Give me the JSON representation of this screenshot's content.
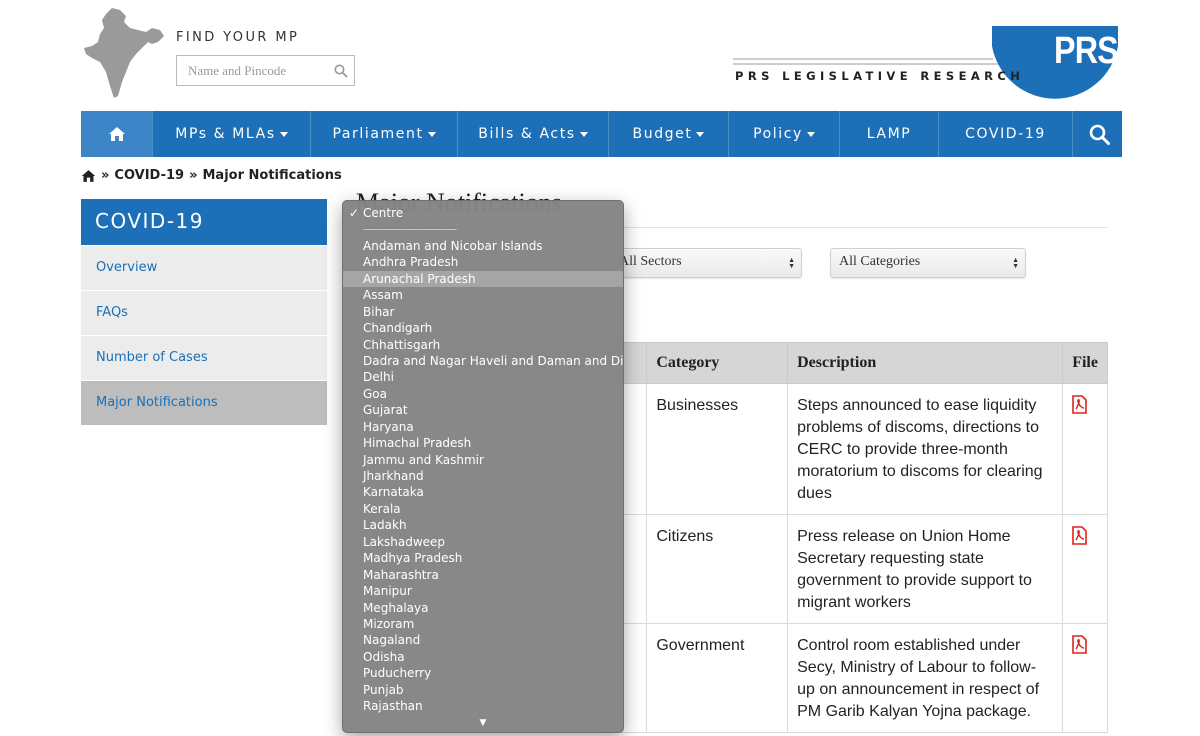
{
  "header": {
    "find_mp_label": "FIND YOUR MP",
    "search_placeholder": "Name and Pincode",
    "logo_text": "PRS LEGISLATIVE RESEARCH",
    "logo_word": "PRS"
  },
  "nav": {
    "items": [
      {
        "label": "MPs & MLAs",
        "dropdown": true
      },
      {
        "label": "Parliament",
        "dropdown": true
      },
      {
        "label": "Bills & Acts",
        "dropdown": true
      },
      {
        "label": "Budget",
        "dropdown": true
      },
      {
        "label": "Policy",
        "dropdown": true
      },
      {
        "label": "LAMP",
        "dropdown": false
      },
      {
        "label": "COVID-19",
        "dropdown": false
      }
    ]
  },
  "breadcrumb": {
    "sep": "»",
    "items": [
      "COVID-19",
      "Major Notifications"
    ]
  },
  "sidebar": {
    "title": "COVID-19",
    "items": [
      {
        "label": "Overview",
        "active": false
      },
      {
        "label": "FAQs",
        "active": false
      },
      {
        "label": "Number of Cases",
        "active": false
      },
      {
        "label": "Major Notifications",
        "active": true
      }
    ]
  },
  "main": {
    "title": "Major Notifications",
    "filters": {
      "sectors": "All Sectors",
      "categories": "All Categories"
    },
    "table": {
      "headers": [
        "Category",
        "Description",
        "File"
      ],
      "rows": [
        {
          "category": "Businesses",
          "description": "Steps announced to ease liquidity problems of discoms, directions to CERC to provide three-month moratorium to discoms for clearing dues"
        },
        {
          "category": "Citizens",
          "description": "Press release on Union Home Secretary requesting state government to provide support to migrant workers"
        },
        {
          "category": "Government",
          "description": "Control room established under Secy, Ministry of Labour to follow-up on announcement in respect of PM Garib Kalyan Yojna package."
        }
      ]
    }
  },
  "dropdown": {
    "selected": "Centre",
    "separator": "----------------------------",
    "highlighted": "Arunachal Pradesh",
    "options": [
      "Andaman and Nicobar Islands",
      "Andhra Pradesh",
      "Arunachal Pradesh",
      "Assam",
      "Bihar",
      "Chandigarh",
      "Chhattisgarh",
      "Dadra and Nagar Haveli and Daman and Diu",
      "Delhi",
      "Goa",
      "Gujarat",
      "Haryana",
      "Himachal Pradesh",
      "Jammu and Kashmir",
      "Jharkhand",
      "Karnataka",
      "Kerala",
      "Ladakh",
      "Lakshadweep",
      "Madhya Pradesh",
      "Maharashtra",
      "Manipur",
      "Meghalaya",
      "Mizoram",
      "Nagaland",
      "Odisha",
      "Puducherry",
      "Punjab",
      "Rajasthan"
    ],
    "more_indicator": "▼"
  },
  "colors": {
    "brand_blue": "#1d70b8",
    "pdf_red": "#e0211b"
  }
}
